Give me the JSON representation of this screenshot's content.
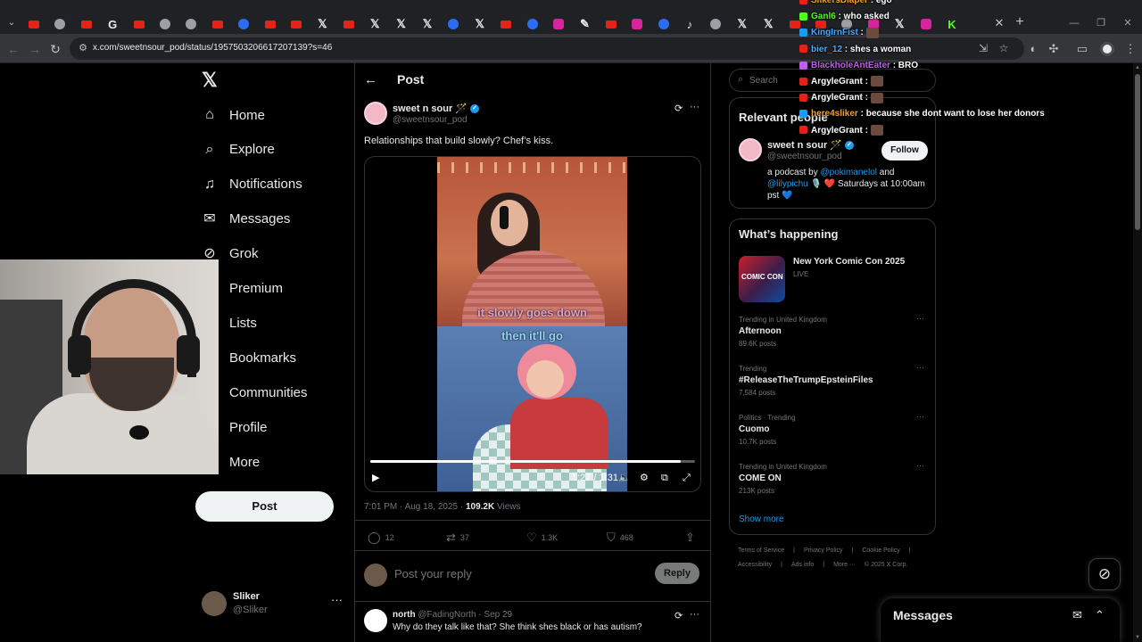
{
  "browser": {
    "url": "x.com/sweetnsour_pod/status/1957503206617207139?s=46",
    "tab_icons": [
      "yt",
      "generic",
      "yt",
      "google",
      "yt",
      "generic",
      "generic",
      "yt",
      "ring",
      "yt",
      "yt",
      "x",
      "yt",
      "x",
      "x",
      "x",
      "ring",
      "x",
      "yt",
      "ring",
      "ig",
      "feather",
      "yt",
      "ig",
      "ring",
      "tiktok",
      "generic",
      "x",
      "x",
      "yt",
      "yt",
      "generic",
      "ig",
      "x",
      "ig",
      "k"
    ]
  },
  "nav": {
    "items": [
      {
        "label": "Home",
        "icon": "home-icon"
      },
      {
        "label": "Explore",
        "icon": "search-icon"
      },
      {
        "label": "Notifications",
        "icon": "bell-icon"
      },
      {
        "label": "Messages",
        "icon": "envelope-icon"
      },
      {
        "label": "Grok",
        "icon": "grok-icon"
      },
      {
        "label": "Premium",
        "icon": "x-icon"
      },
      {
        "label": "Lists",
        "icon": "list-icon"
      },
      {
        "label": "Bookmarks",
        "icon": "bookmark-icon"
      },
      {
        "label": "Communities",
        "icon": "people-icon"
      },
      {
        "label": "Profile",
        "icon": "user-icon"
      },
      {
        "label": "More",
        "icon": "more-icon"
      }
    ],
    "post_button": "Post",
    "me": {
      "name": "Sliker",
      "handle": "@Sliker"
    }
  },
  "post": {
    "header_title": "Post",
    "author_name": "sweet n sour 🪄",
    "author_handle": "@sweetnsour_pod",
    "text": "Relationships that build slowly? Chef’s kiss.",
    "caption_line1": "it slowly goes down",
    "caption_line2": "then it'll go",
    "video_time": "1:27 / 1:31",
    "video_progress": 0.956,
    "timestamp": "7:01 PM · Aug 18, 2025 · ",
    "views_count": "109.2K",
    "views_label": " Views",
    "replies": "12",
    "reposts": "37",
    "likes": "1.3K",
    "bookmarks": "468",
    "reply_placeholder": "Post your reply",
    "reply_button": "Reply"
  },
  "comment": {
    "name": "north",
    "meta": " @FadingNorth · Sep 29",
    "text": "Why do they talk like that? She think shes black or has autism?"
  },
  "sidebar": {
    "search_placeholder": "Search",
    "relevant_title": "Relevant people",
    "person_name": "sweet n sour 🪄",
    "person_handle": "@sweetnsour_pod",
    "follow_label": "Follow",
    "bio_prefix": "a podcast by ",
    "bio_link1": "@pokimanelol",
    "bio_and": " and ",
    "bio_link2": "@lilypichu",
    "bio_suffix": " 🎙️ ❤️ Saturdays at 10:00am pst 💙",
    "happening_title": "What’s happening",
    "event_name": "New York Comic Con 2025",
    "event_status": "LIVE",
    "trends": [
      {
        "context": "Trending in United Kingdom",
        "name": "Afternoon",
        "count": "89.6K posts"
      },
      {
        "context": "Trending",
        "name": "#ReleaseTheTrumpEpsteinFiles",
        "count": "7,584 posts"
      },
      {
        "context": "Politics · Trending",
        "name": "Cuomo",
        "count": "10.7K posts"
      },
      {
        "context": "Trending in United Kingdom",
        "name": "COME ON",
        "count": "213K posts"
      }
    ],
    "show_more": "Show more",
    "footer_links": [
      "Terms of Service",
      "|",
      "Privacy Policy",
      "|",
      "Cookie Policy",
      "|",
      "Accessibility",
      "|",
      "Ads info",
      "|",
      "More ···",
      "© 2025 X Corp."
    ]
  },
  "messages_drawer": {
    "title": "Messages"
  },
  "chat": [
    {
      "user": "SlikersDiaper",
      "color": "#f0a030",
      "msg": " : ego"
    },
    {
      "user": "Ganl6",
      "color": "#53fc18",
      "msg": " : who asked"
    },
    {
      "user": "KingIrnFist",
      "color": "#4aa8ff",
      "msg": " :"
    },
    {
      "user": "bier_12",
      "color": "#4aa8ff",
      "msg": " : shes a woman"
    },
    {
      "user": "BlackholeAntEater",
      "color": "#c05cf0",
      "msg": " :      BRO"
    },
    {
      "user": "ArgyleGrant",
      "color": "#ffffff",
      "msg": " :"
    },
    {
      "user": "ArgyleGrant",
      "color": "#ffffff",
      "msg": " :"
    },
    {
      "user": "here4sliker",
      "color": "#f0a030",
      "msg": " : because she dont want to lose her donors"
    },
    {
      "user": "ArgyleGrant",
      "color": "#ffffff",
      "msg": " :"
    }
  ]
}
